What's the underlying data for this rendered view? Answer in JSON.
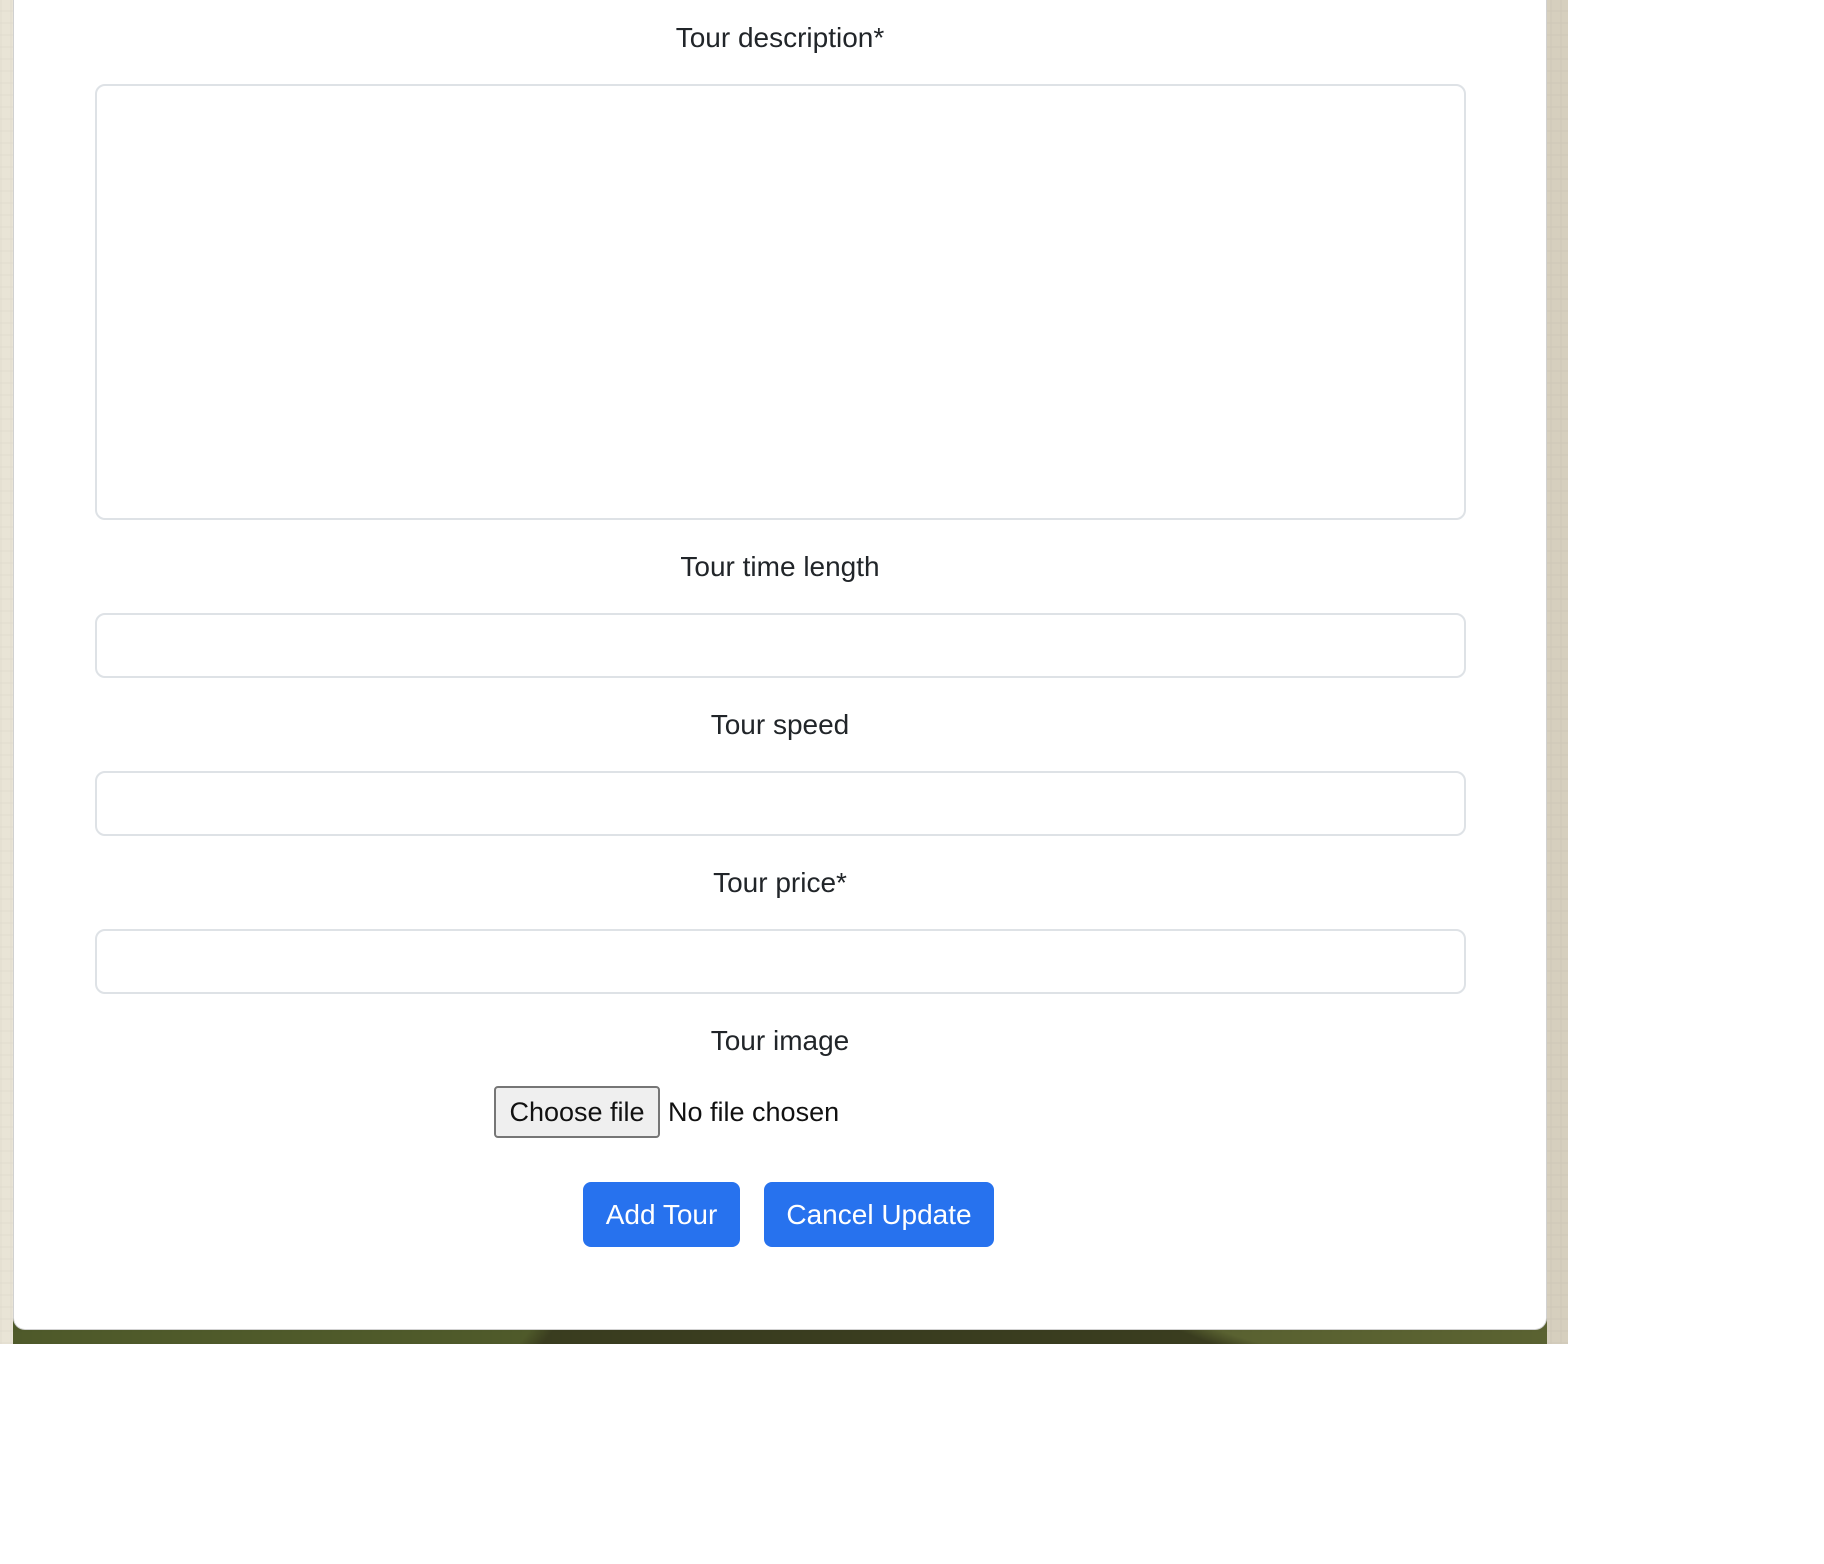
{
  "form": {
    "fields": {
      "description": {
        "label": "Tour description*",
        "value": ""
      },
      "time_length": {
        "label": "Tour time length",
        "value": ""
      },
      "speed": {
        "label": "Tour speed",
        "value": ""
      },
      "price": {
        "label": "Tour price*",
        "value": ""
      },
      "image": {
        "label": "Tour image",
        "button_label": "Choose file",
        "status_text": "No file chosen"
      }
    },
    "actions": {
      "add_label": "Add Tour",
      "cancel_label": "Cancel Update"
    }
  },
  "colors": {
    "primary": "#2772ee",
    "border": "#dee2e6",
    "text": "#212529",
    "panel": "#ffffff"
  }
}
